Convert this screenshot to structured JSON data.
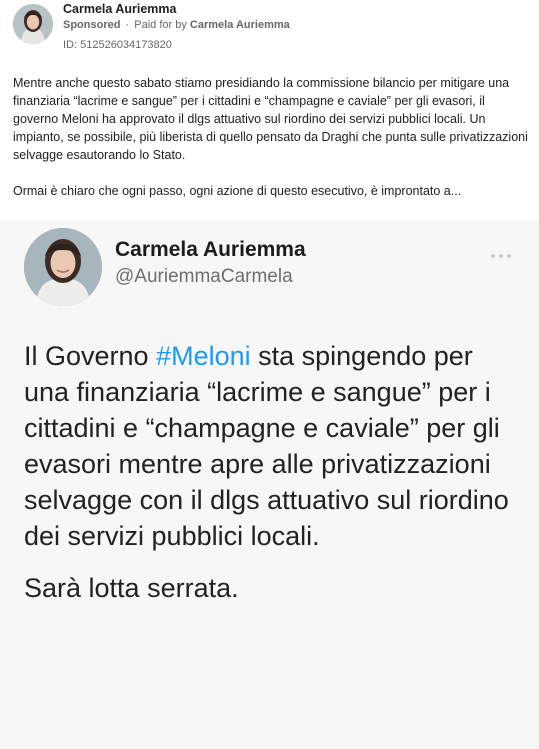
{
  "post": {
    "author": "Carmela Auriemma",
    "sponsored": "Sponsored",
    "separator": "·",
    "paid_for_prefix": "Paid for by",
    "paid_for_by": "Carmela Auriemma",
    "ad_id": "ID: 512526034173820",
    "text_paragraph_1": "Mentre anche questo sabato stiamo presidiando la commissione bilancio per mitigare una finanziaria “lacrime e sangue” per i cittadini e “champagne e caviale” per gli evasori, il governo Meloni ha approvato il dlgs attuativo sul riordino dei servizi pubblici locali. Un impianto, se possibile, più liberista di quello pensato da Draghi che punta sulle privatizzazioni selvagge esautorando lo Stato.",
    "text_paragraph_2": "Ormai è chiaro che ogni passo, ogni azione di questo esecutivo, è improntato a..."
  },
  "tweet": {
    "name": "Carmela Auriemma",
    "handle": "@AuriemmaCarmela",
    "text_prefix": "Il Governo ",
    "hashtag": "#Meloni",
    "text_rest": " sta spingendo per una finanziaria “lacrime e sangue” per i cittadini e “champagne e caviale” per gli evasori mentre apre alle privatizzazioni selvagge con il dlgs attuativo sul riordino dei servizi pubblici locali.",
    "closing": "Sarà lotta serrata."
  },
  "icons": {
    "more_options": "more-horizontal-icon"
  },
  "colors": {
    "hashtag": "#1d9bf0",
    "meta_text": "#65676b",
    "card_background": "#f7f7f7"
  }
}
